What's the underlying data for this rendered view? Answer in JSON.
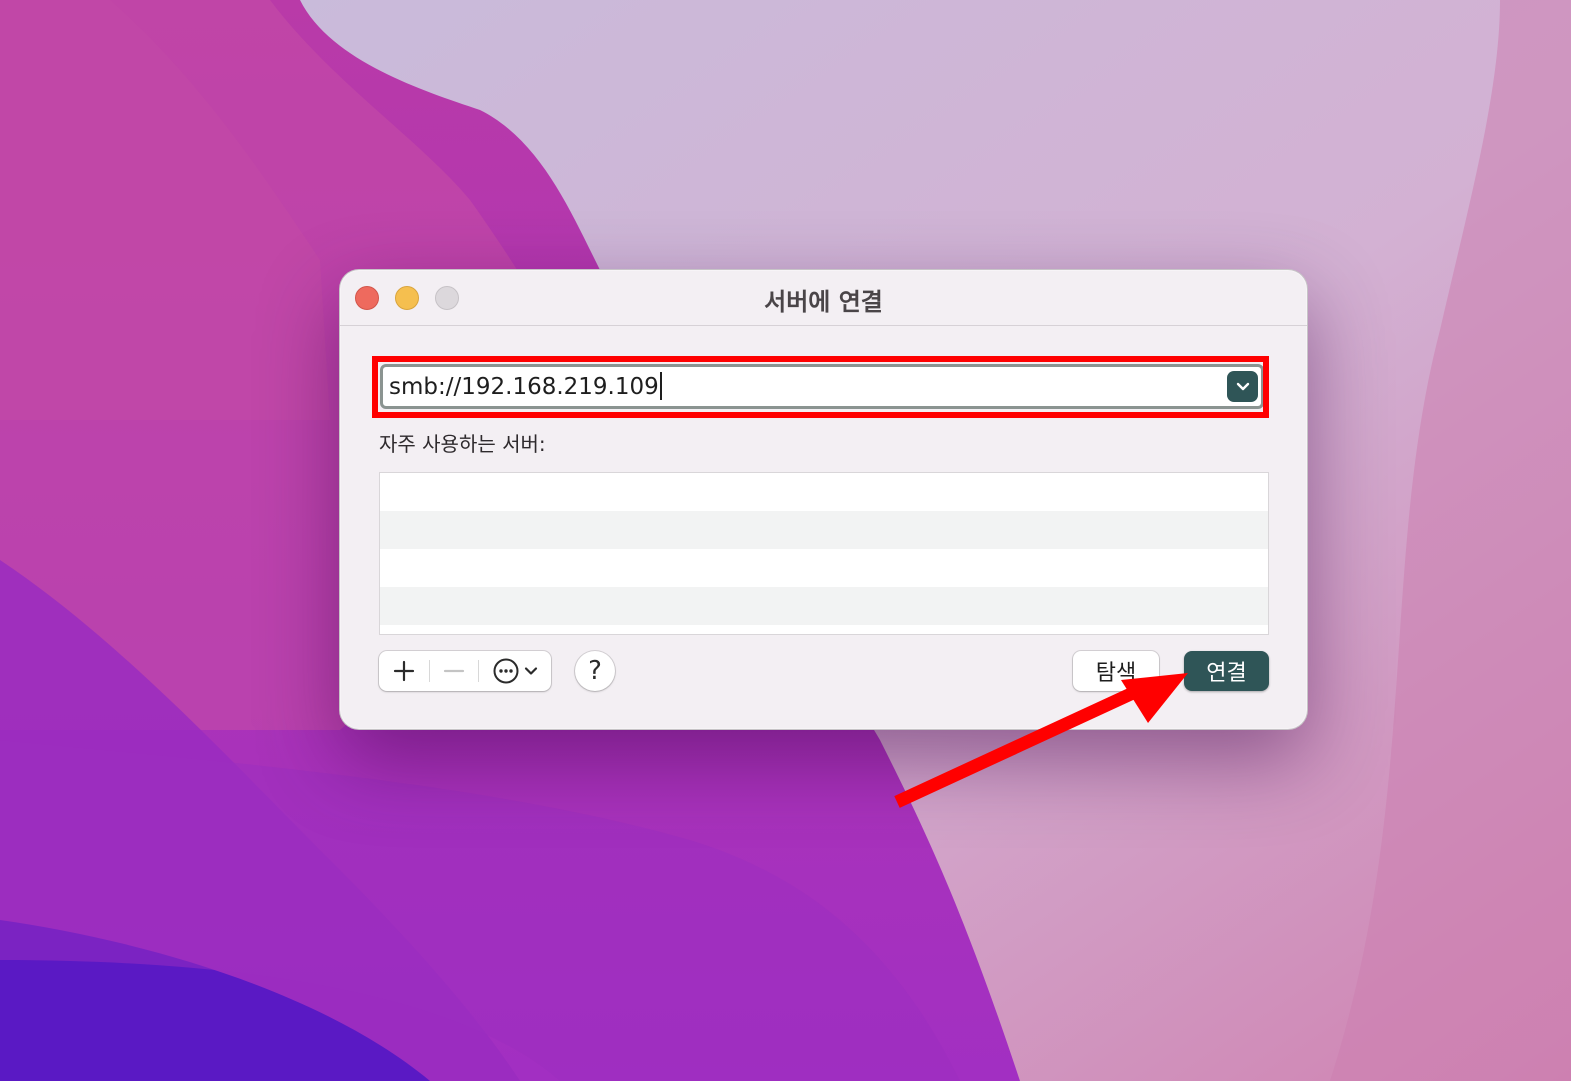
{
  "dialog": {
    "title": "서버에 연결",
    "address_value": "smb://192.168.219.109",
    "favorites_label": "자주 사용하는 서버:",
    "favorites": [],
    "browse_label": "탐색",
    "connect_label": "연결",
    "help_label": "?"
  },
  "icons": {
    "close": "close-dot",
    "minimize": "minimize-dot",
    "zoom": "zoom-dot",
    "dropdown": "chevron-down-icon",
    "add": "plus-icon",
    "remove": "minus-icon",
    "more": "ellipsis-circle-icon"
  },
  "colors": {
    "accent": "#2f5557",
    "annotation": "#ff0000"
  }
}
